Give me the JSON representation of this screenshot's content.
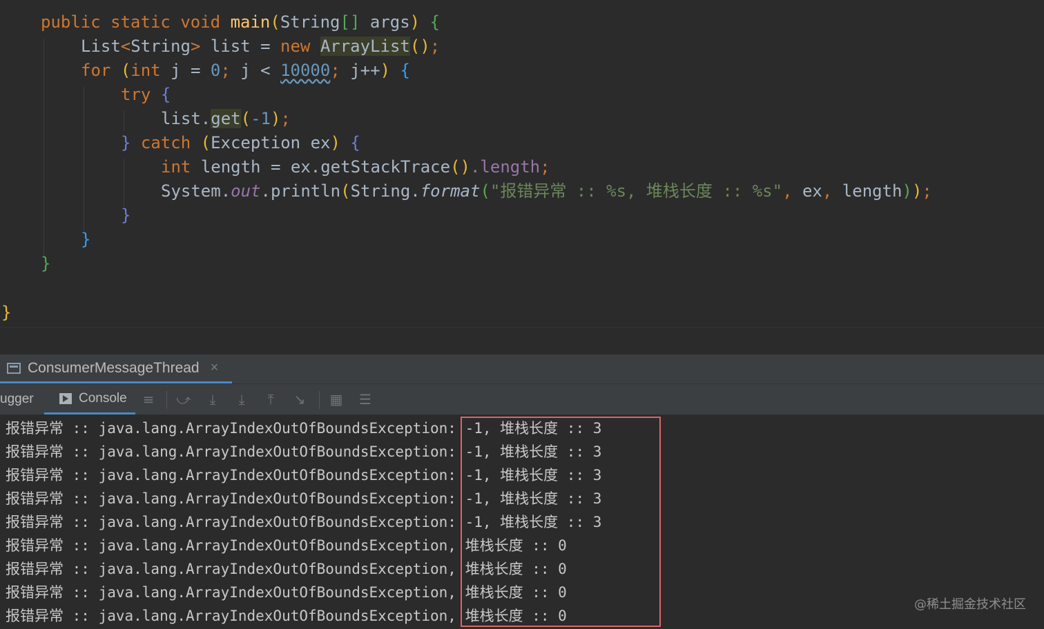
{
  "editor": {
    "lines": [
      "    public static void main(String[] args) {",
      "        List<String> list = new ArrayList();",
      "        for (int j = 0; j < 10000; j++) {",
      "            try {",
      "                list.get(-1);",
      "            } catch (Exception ex) {",
      "                int length = ex.getStackTrace().length;",
      "                System.out.println(String.format(\"报错异常 :: %s, 堆栈长度 :: %s\", ex, length));",
      "            }",
      "        }",
      "    }",
      "",
      "}"
    ],
    "tokens": {
      "public": "public",
      "static": "static",
      "void": "void",
      "main": "main",
      "string_type": "String",
      "arr": "[]",
      "args": "args",
      "list_type": "List",
      "lt": "<",
      "gt": ">",
      "list_var": "list",
      "eq": " = ",
      "new": "new",
      "arraylist": "ArrayList",
      "call_end": "();",
      "for": "for",
      "int": "int",
      "j": "j",
      "zero": "0",
      "semi": ";",
      "less": " < ",
      "limit": "10000",
      "jpp": "j++",
      "try": "try",
      "get": "get",
      "minus_one": "-1",
      "catch": "catch",
      "exception": "Exception",
      "ex": "ex",
      "length_var": "length",
      "getst": "ex.getStackTrace",
      "dot_length": ".length",
      "system": "System",
      "out": "out",
      "println": "println",
      "format": "format",
      "string_literal": "\"报错异常 :: %s, 堆栈长度 :: %s\"",
      "ex_arg": "ex",
      "length_arg": "length"
    }
  },
  "run_panel": {
    "tab_title": "ConsumerMessageThread",
    "close_glyph": "×",
    "debugger_label": "ugger",
    "console_label": "Console",
    "toolbar_icons": [
      "menu-icon",
      "step-over-icon",
      "step-into-icon",
      "force-step-into-icon",
      "step-out-icon",
      "run-to-cursor-icon",
      "evaluate-icon",
      "trace-icon"
    ]
  },
  "console_output": [
    "报错异常 :: java.lang.ArrayIndexOutOfBoundsException: -1, 堆栈长度 :: 3",
    "报错异常 :: java.lang.ArrayIndexOutOfBoundsException: -1, 堆栈长度 :: 3",
    "报错异常 :: java.lang.ArrayIndexOutOfBoundsException: -1, 堆栈长度 :: 3",
    "报错异常 :: java.lang.ArrayIndexOutOfBoundsException: -1, 堆栈长度 :: 3",
    "报错异常 :: java.lang.ArrayIndexOutOfBoundsException: -1, 堆栈长度 :: 3",
    "报错异常 :: java.lang.ArrayIndexOutOfBoundsException, 堆栈长度 :: 0",
    "报错异常 :: java.lang.ArrayIndexOutOfBoundsException, 堆栈长度 :: 0",
    "报错异常 :: java.lang.ArrayIndexOutOfBoundsException, 堆栈长度 :: 0",
    "报错异常 :: java.lang.ArrayIndexOutOfBoundsException, 堆栈长度 :: 0"
  ],
  "watermark": "@稀土掘金技术社区",
  "colors": {
    "background": "#2b2b2b",
    "keyword": "#cc7832",
    "function": "#ffc66d",
    "number": "#6897bb",
    "string": "#6a8759",
    "field": "#9876aa",
    "highlight_box": "#e0636a",
    "tab_underline": "#4a88c7"
  }
}
